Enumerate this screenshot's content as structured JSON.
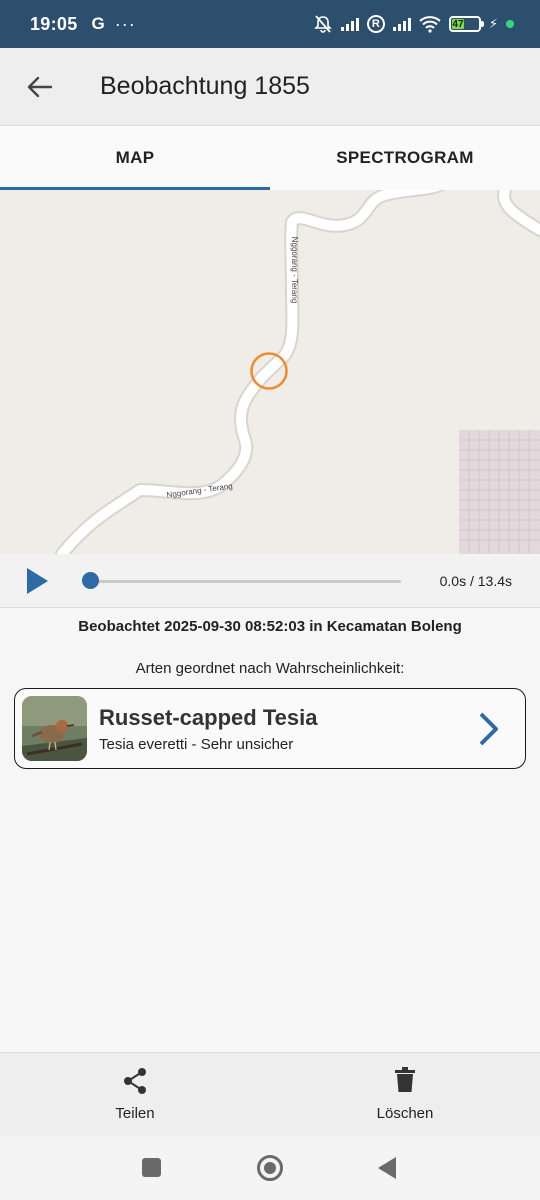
{
  "status_bar": {
    "time": "19:05",
    "g_icon": "G",
    "more": "···",
    "battery_level": "47",
    "icons": [
      "mute-bell-icon",
      "signal-icon",
      "roaming-r-icon",
      "signal-icon",
      "wifi-icon",
      "battery-icon",
      "charging-bolt-icon",
      "green-dot"
    ]
  },
  "app_bar": {
    "title": "Beobachtung 1855",
    "back_icon": "arrow-left-icon"
  },
  "tabs": [
    {
      "label": "MAP",
      "active": true
    },
    {
      "label": "SPECTROGRAM",
      "active": false
    }
  ],
  "map": {
    "road_label_1": "Nggorang - Terang",
    "road_label_2": "Nggorang - Terang",
    "marker": "orange-circle-location-marker"
  },
  "player": {
    "time_readout": "0.0s / 13.4s",
    "progress": 0.0,
    "play_icon": "play-icon"
  },
  "observation": {
    "text": "Beobachtet 2025-09-30 08:52:03 in Kecamatan Boleng",
    "sorted_label": "Arten geordnet nach Wahrscheinlichkeit:"
  },
  "species": [
    {
      "name": "Russet-capped Tesia",
      "subtitle": "Tesia everetti - Sehr unsicher",
      "chevron_icon": "chevron-right-icon"
    }
  ],
  "bottom_bar": {
    "share_label": "Teilen",
    "delete_label": "Löschen"
  },
  "colors": {
    "status_bar": "#2d4f6e",
    "accent": "#2d6aa6",
    "marker": "#f08a2c",
    "map_bg": "#f0ede8"
  }
}
